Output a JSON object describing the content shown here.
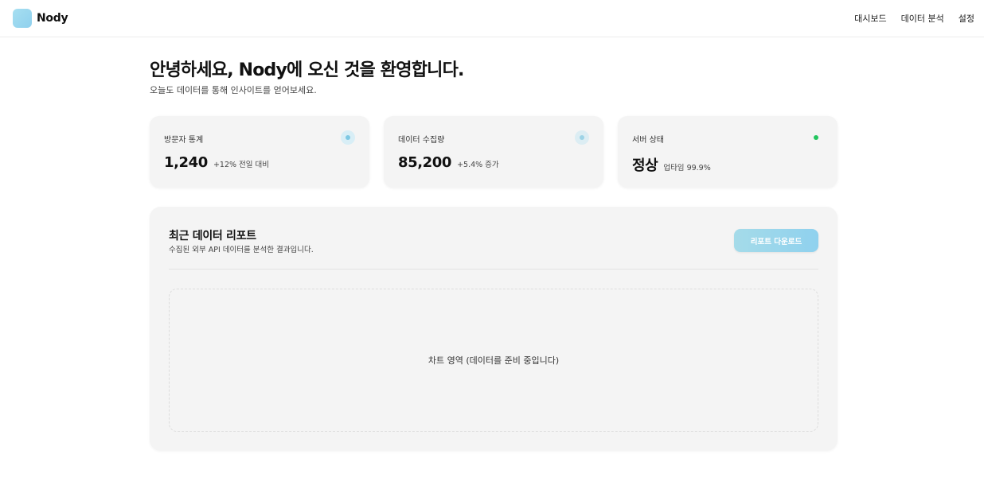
{
  "app": {
    "name": "Nody"
  },
  "nav": {
    "items": [
      {
        "label": "대시보드"
      },
      {
        "label": "데이터 분석"
      },
      {
        "label": "설정"
      }
    ]
  },
  "hero": {
    "title": "안녕하세요, Nody에 오신 것을 환영합니다.",
    "subtitle": "오늘도 데이터를 통해 인사이트를 얻어보세요."
  },
  "stats": [
    {
      "label": "방문자 통계",
      "value": "1,240",
      "delta": "+12% 전일 대비",
      "indicator_color": "#7ec8e3",
      "indicator_bg": "#d8eef6"
    },
    {
      "label": "데이터 수집량",
      "value": "85,200",
      "delta": "+5.4% 증가",
      "indicator_color": "#9dd3e6",
      "indicator_bg": "#dcedf3"
    },
    {
      "label": "서버 상태",
      "value": "정상",
      "delta": "업타임 99.9%",
      "indicator_color": "#22c55e",
      "indicator_bg": "#f4f4f4"
    }
  ],
  "report": {
    "title": "최근 데이터 리포트",
    "subtitle": "수집된 외부 API 데이터를 분석한 결과입니다.",
    "download_label": "리포트 다운로드",
    "chart_placeholder": "차트 영역 (데이터를 준비 중입니다)"
  },
  "colors": {
    "accent": "#8fd1ee",
    "status_ok": "#22c55e"
  }
}
